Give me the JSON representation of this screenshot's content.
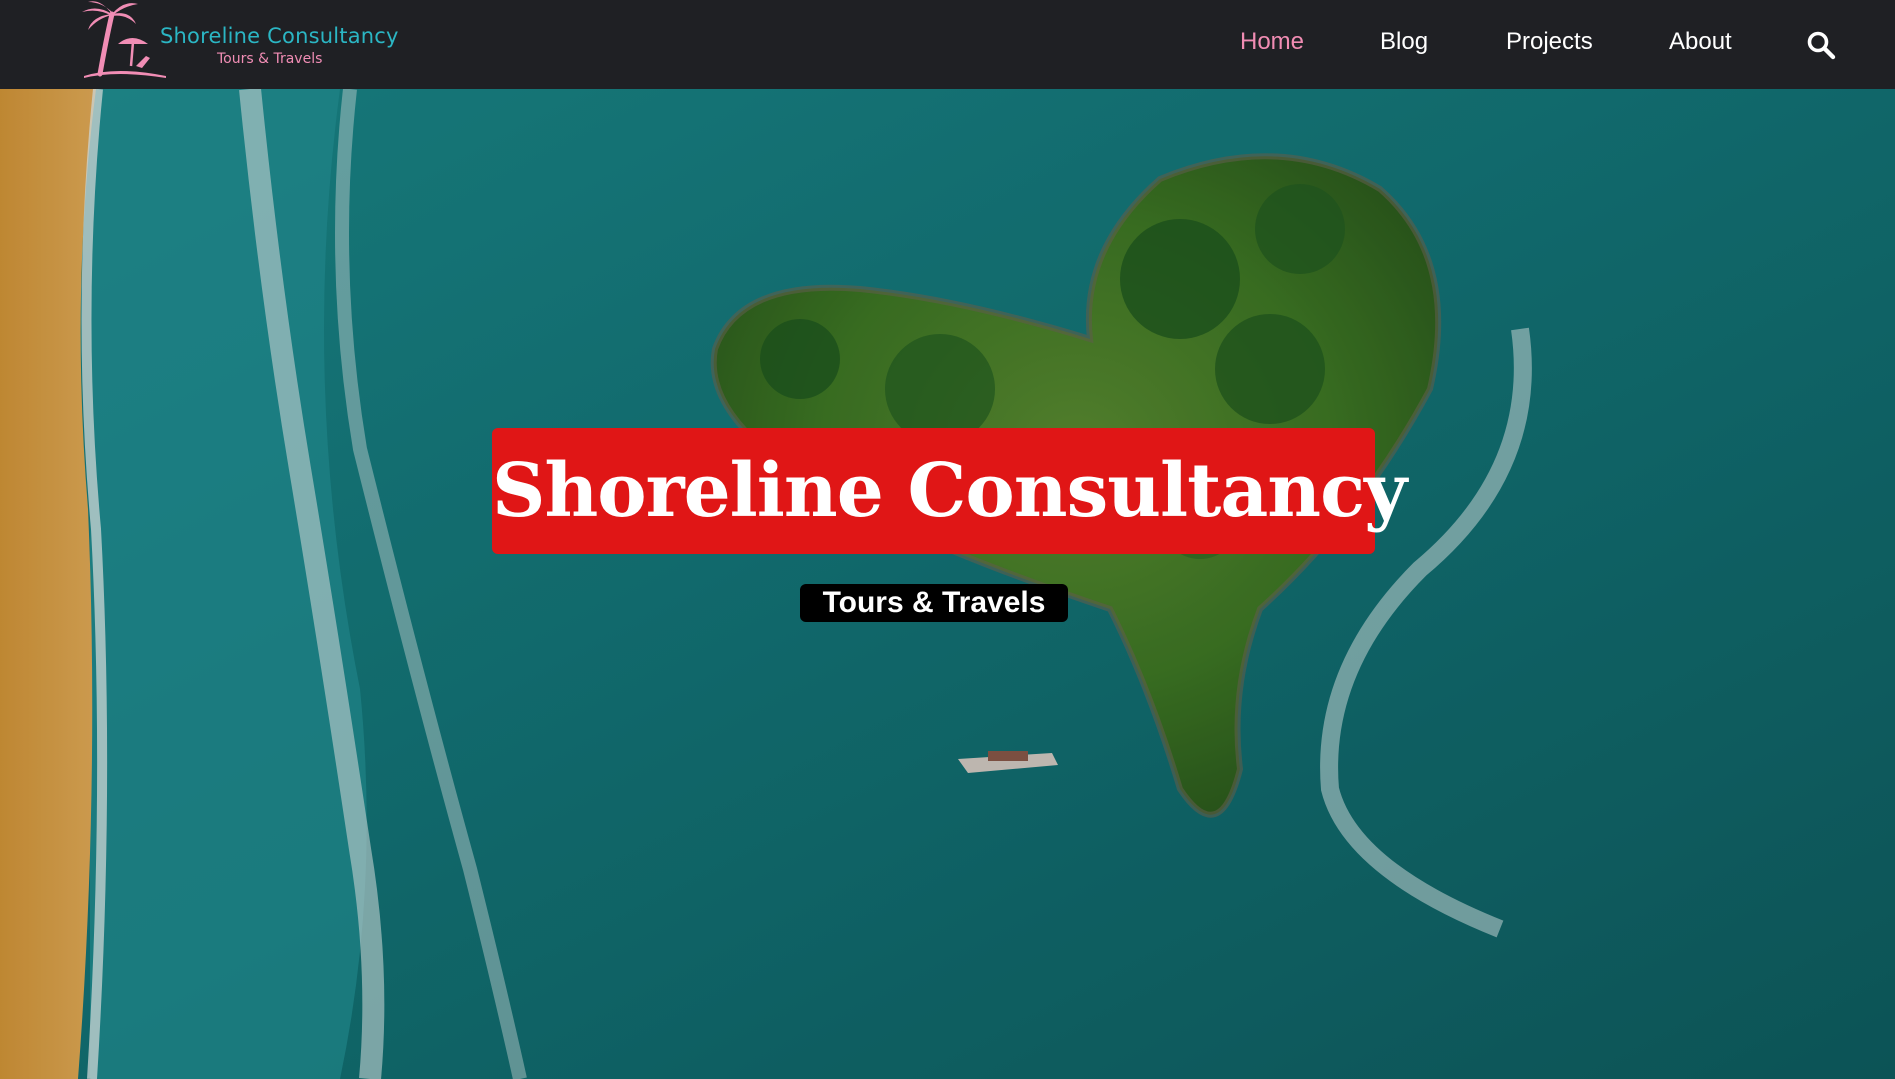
{
  "header": {
    "logo": {
      "title": "Shoreline Consultancy",
      "subtitle": "Tours & Travels",
      "icon": "palm-tree-beach-icon"
    },
    "nav": [
      {
        "label": "Home",
        "active": true
      },
      {
        "label": "Blog",
        "active": false
      },
      {
        "label": "Projects",
        "active": false
      },
      {
        "label": "About",
        "active": false
      }
    ],
    "search_icon": "search-icon"
  },
  "hero": {
    "title": "Shoreline Consultancy",
    "subtitle": "Tours & Travels",
    "background": "aerial-heart-shaped-island-photo"
  },
  "colors": {
    "header_bg": "#1f2024",
    "nav_active": "#f08cb3",
    "nav_text": "#ffffff",
    "logo_title": "#2bb6c4",
    "logo_accent": "#f18db5",
    "hero_title_bg": "#e01616",
    "hero_sub_bg": "#000000"
  }
}
